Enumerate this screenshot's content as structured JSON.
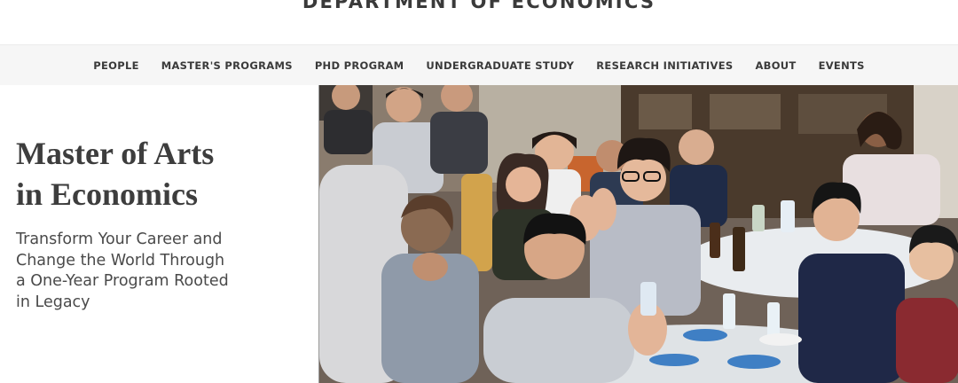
{
  "header": {
    "department_title": "DEPARTMENT OF ECONOMICS"
  },
  "nav": {
    "items": [
      {
        "label": "PEOPLE"
      },
      {
        "label": "MASTER'S PROGRAMS"
      },
      {
        "label": "PHD PROGRAM"
      },
      {
        "label": "UNDERGRADUATE STUDY"
      },
      {
        "label": "RESEARCH INITIATIVES"
      },
      {
        "label": "ABOUT"
      },
      {
        "label": "EVENTS"
      }
    ]
  },
  "hero": {
    "title_line1": "Master of Arts",
    "title_line2": "in Economics",
    "subtitle": "Transform Your Career and Change the World Through a One-Year Program Rooted in Legacy",
    "image_description": "Students seated around banquet tables applauding and smiling"
  },
  "colors": {
    "text_dark": "#3a3a3a",
    "nav_background": "#f6f6f6",
    "page_background": "#ffffff"
  }
}
